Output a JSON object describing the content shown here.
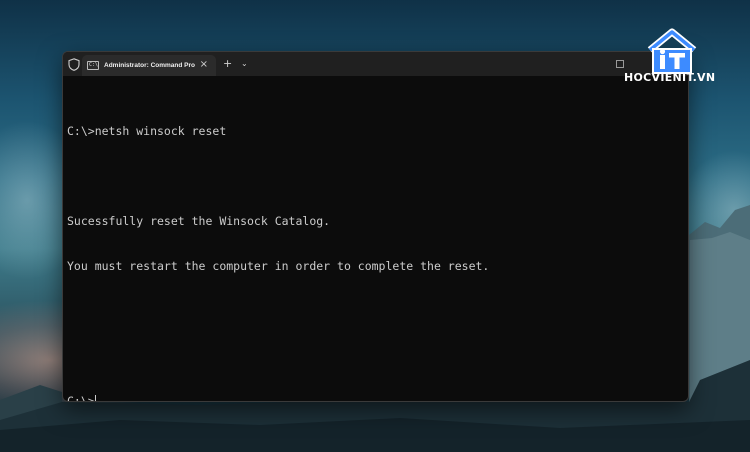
{
  "window": {
    "tab_title": "Administrator: Command Pro",
    "tab_close_glyph": "×",
    "new_tab_glyph": "+",
    "dropdown_glyph": "⌄",
    "tab_icon_text": "C:\\",
    "icons": {
      "shield": "shield-icon",
      "terminal": "terminal-icon",
      "close": "close-icon",
      "new_tab": "plus-icon",
      "dropdown": "chevron-down-icon",
      "minimize": "window-button-icon"
    }
  },
  "terminal": {
    "lines": [
      "C:\\>netsh winsock reset",
      "",
      "Sucessfully reset the Winsock Catalog.",
      "You must restart the computer in order to complete the reset.",
      "",
      "",
      "C:\\>"
    ]
  },
  "logo": {
    "text": "HOCVIENIT.VN",
    "mark": "iT"
  },
  "colors": {
    "terminal_bg": "#0c0c0c",
    "terminal_fg": "#cccccc",
    "titlebar_bg": "#202020",
    "tab_bg": "#2b2b2b",
    "logo_blue": "#3d8bff"
  }
}
